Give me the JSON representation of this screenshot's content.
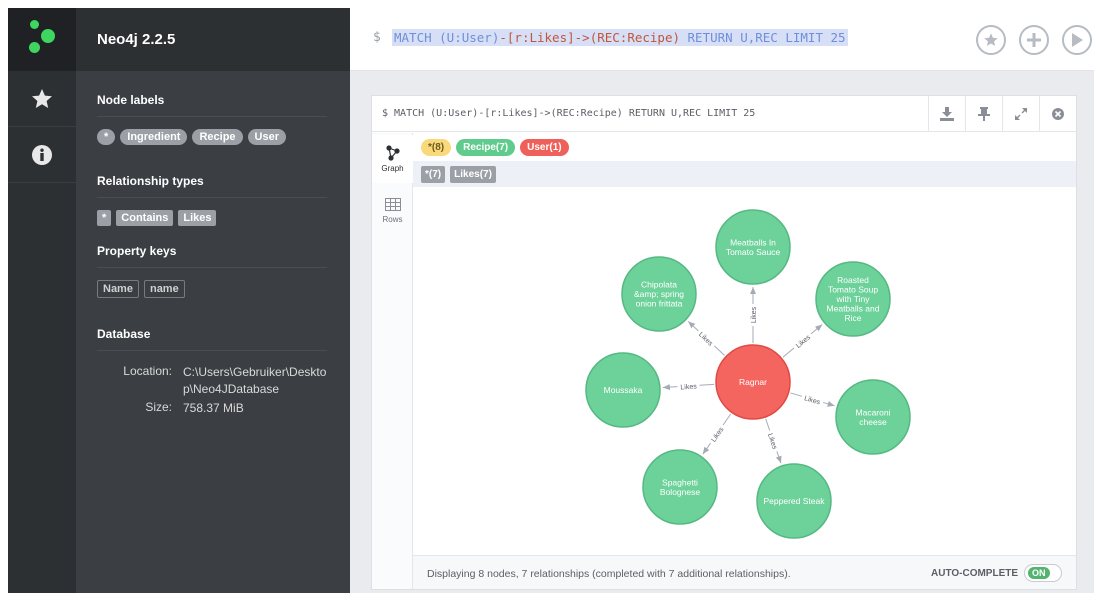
{
  "app": {
    "title": "Neo4j 2.2.5"
  },
  "rail": {
    "items": [
      "star-icon",
      "info-icon"
    ]
  },
  "drawer": {
    "node_labels_title": "Node labels",
    "node_labels": [
      "*",
      "Ingredient",
      "Recipe",
      "User"
    ],
    "relationship_types_title": "Relationship types",
    "relationship_types": [
      "*",
      "Contains",
      "Likes"
    ],
    "property_keys_title": "Property keys",
    "property_keys": [
      "Name",
      "name"
    ],
    "database_title": "Database",
    "location_label": "Location:",
    "location_value_1": "C:\\Users\\Gebruiker\\Deskto",
    "location_value_2": "p\\Neo4JDatabase",
    "size_label": "Size:",
    "size_value": "758.37 MiB"
  },
  "editor": {
    "prompt": "$",
    "query_parts": {
      "match": "MATCH ",
      "user": "(U:User)",
      "rel": "-[r:Likes]->",
      "recipe": "(REC:Recipe)",
      "ret": " RETURN U,REC LIMIT 25"
    }
  },
  "frame": {
    "query": "$ MATCH (U:User)-[r:Likes]->(REC:Recipe) RETURN U,REC LIMIT 25",
    "tabs": {
      "graph": "Graph",
      "rows": "Rows"
    },
    "legend_nodes": [
      {
        "label": "*(8)",
        "color": "#fad97a",
        "text_color": "#6b5a1f"
      },
      {
        "label": "Recipe(7)",
        "color": "#5fcb8c",
        "text_color": "#ffffff"
      },
      {
        "label": "User(1)",
        "color": "#f0605a",
        "text_color": "#ffffff"
      }
    ],
    "legend_rels": [
      "*(7)",
      "Likes(7)"
    ],
    "footer": "Displaying 8 nodes, 7 relationships (completed with 7 additional relationships).",
    "autocomplete_label": "AUTO-COMPLETE",
    "autocomplete_state": "ON"
  },
  "graph": {
    "center": {
      "lines": [
        "Ragnar"
      ],
      "color": "#f4655f"
    },
    "nodes": [
      {
        "lines": [
          "Meatballs In",
          "Tomato Sauce"
        ],
        "color": "#6dd19a"
      },
      {
        "lines": [
          "Roasted",
          "Tomato Soup",
          "with Tiny",
          "Meatballs and",
          "Rice"
        ],
        "color": "#6dd19a"
      },
      {
        "lines": [
          "Macaroni",
          "cheese"
        ],
        "color": "#6dd19a"
      },
      {
        "lines": [
          "Peppered Steak"
        ],
        "color": "#6dd19a"
      },
      {
        "lines": [
          "Spaghetti",
          "Bolognese"
        ],
        "color": "#6dd19a"
      },
      {
        "lines": [
          "Moussaka"
        ],
        "color": "#6dd19a"
      },
      {
        "lines": [
          "Chipolata",
          "&amp; spring",
          "onion frittata"
        ],
        "color": "#6dd19a"
      }
    ],
    "edge_label": "Likes"
  }
}
